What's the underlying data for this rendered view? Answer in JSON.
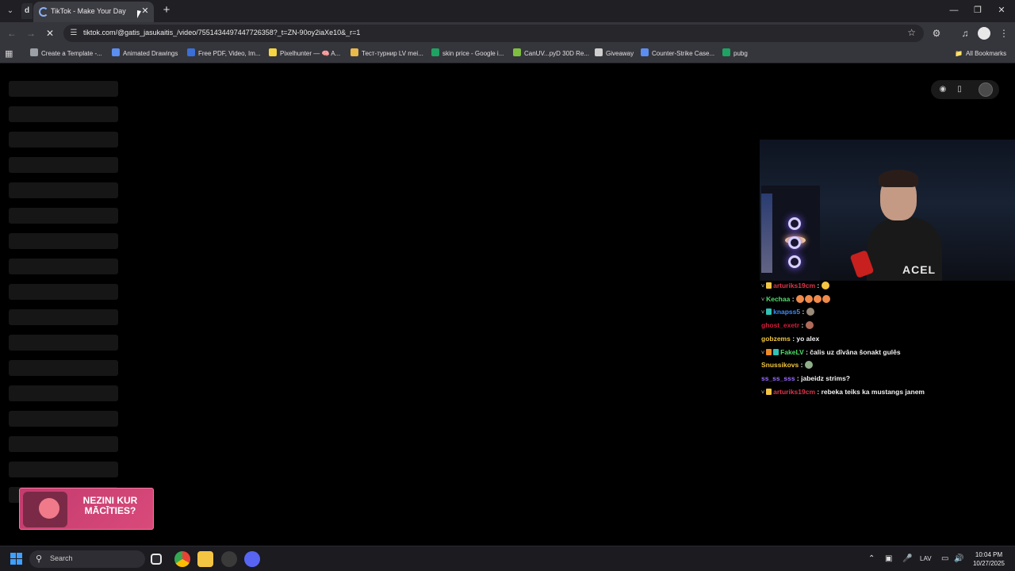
{
  "browser": {
    "active_tab_title": "TikTok - Make Your Day",
    "pinned_tab_label": "d",
    "url": "tiktok.com/@gatis_jasukaitis_/video/7551434497447726358?_t=ZN-90oy2iaXe10&_r=1",
    "bookmarks": [
      {
        "label": "Create a Template -...",
        "color": "#9aa0a6"
      },
      {
        "label": "Animated Drawings",
        "color": "#5b8ef0"
      },
      {
        "label": "Free PDF, Video, Im...",
        "color": "#3a6fd8"
      },
      {
        "label": "Pixelhunter — 🧠 A...",
        "color": "#f5d542"
      },
      {
        "label": "Тест-турнир LV mei...",
        "color": "#e8b84a"
      },
      {
        "label": "skin price - Google i...",
        "color": "#1ea362"
      },
      {
        "label": "CanUV...pyD 30D Re...",
        "color": "#7fbf3f"
      },
      {
        "label": "Giveaway",
        "color": "#cfcfcf"
      },
      {
        "label": "Counter-Strike Case...",
        "color": "#5b8ef0"
      },
      {
        "label": "pubg",
        "color": "#1ea362"
      }
    ],
    "all_bookmarks_label": "All Bookmarks"
  },
  "page": {
    "shirt_text": "ACEL",
    "promo_text": "NEZINI KUR MĀCĪTIES?"
  },
  "chat": [
    {
      "user": "arturiks19cm",
      "user_color": "#e0344a",
      "badges": [
        "v",
        "gold"
      ],
      "text": "",
      "emotes": [
        "#f4c542"
      ]
    },
    {
      "user": "Kechaa",
      "user_color": "#4ede6a",
      "badges": [
        "v"
      ],
      "text": "",
      "emotes": [
        "#f08a4a",
        "#f08a4a",
        "#f08a4a",
        "#f08a4a"
      ]
    },
    {
      "user": "knapss5",
      "user_color": "#3c8cff",
      "badges": [
        "v",
        "teal"
      ],
      "text": "",
      "emotes": [
        "#9b8a7a"
      ]
    },
    {
      "user": "ghost_exetr",
      "user_color": "#d01e3a",
      "badges": [],
      "text": "",
      "emotes": [
        "#b06a5a"
      ]
    },
    {
      "user": "gobzems",
      "user_color": "#f0c640",
      "badges": [],
      "text": "yo alex",
      "emotes": []
    },
    {
      "user": "FakeLV",
      "user_color": "#4ede6a",
      "badges": [
        "v",
        "orange",
        "teal"
      ],
      "text": "čalis uz dīvāna šonakt gulēs",
      "emotes": []
    },
    {
      "user": "Snussikovs",
      "user_color": "#f0c640",
      "badges": [],
      "text": "",
      "emotes": [
        "#8fae8a"
      ]
    },
    {
      "user": "ss_ss_sss",
      "user_color": "#9a6cff",
      "badges": [],
      "text": "jabeidz strims?",
      "emotes": []
    },
    {
      "user": "arturiks19cm",
      "user_color": "#e0344a",
      "badges": [
        "v",
        "gold"
      ],
      "text": "rebeka teiks ka mustangs janem",
      "emotes": []
    }
  ],
  "taskbar": {
    "search_placeholder": "Search",
    "language": "LAV",
    "time": "10:04 PM",
    "date": "10/27/2025"
  }
}
